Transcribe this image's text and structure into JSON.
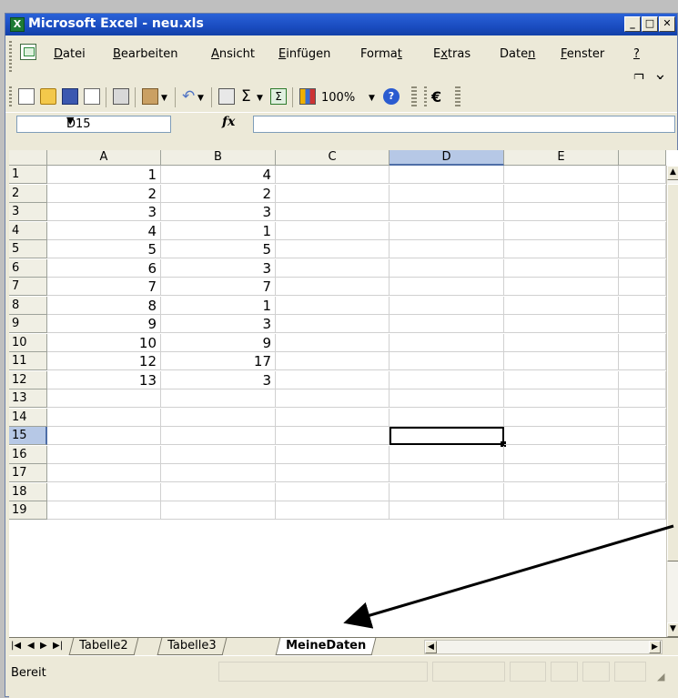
{
  "window": {
    "title": "Microsoft Excel - neu.xls"
  },
  "menu": {
    "items": [
      {
        "label": "Datei",
        "mn": "D"
      },
      {
        "label": "Bearbeiten",
        "mn": "B"
      },
      {
        "label": "Ansicht",
        "mn": "A"
      },
      {
        "label": "Einfügen",
        "mn": "E"
      },
      {
        "label": "Format",
        "mn": "t"
      },
      {
        "label": "Extras",
        "mn": "x"
      },
      {
        "label": "Daten",
        "mn": "n"
      },
      {
        "label": "Fenster",
        "mn": "F"
      },
      {
        "label": "?",
        "mn": "?"
      }
    ]
  },
  "toolbar": {
    "zoom": "100%",
    "euro": "€",
    "sum": "Σ"
  },
  "formula_bar": {
    "cell_ref": "D15",
    "fx": "fx",
    "value": ""
  },
  "columns": [
    "A",
    "B",
    "C",
    "D",
    "E"
  ],
  "selected_column": "D",
  "selected_row": 15,
  "active_cell": "D15",
  "rows": [
    {
      "n": "1",
      "a": "1",
      "b": "4"
    },
    {
      "n": "2",
      "a": "2",
      "b": "2"
    },
    {
      "n": "3",
      "a": "3",
      "b": "3"
    },
    {
      "n": "4",
      "a": "4",
      "b": "1"
    },
    {
      "n": "5",
      "a": "5",
      "b": "5"
    },
    {
      "n": "6",
      "a": "6",
      "b": "3"
    },
    {
      "n": "7",
      "a": "7",
      "b": "7"
    },
    {
      "n": "8",
      "a": "8",
      "b": "1"
    },
    {
      "n": "9",
      "a": "9",
      "b": "3"
    },
    {
      "n": "10",
      "a": "10",
      "b": "9"
    },
    {
      "n": "11",
      "a": "12",
      "b": "17"
    },
    {
      "n": "12",
      "a": "13",
      "b": "3"
    },
    {
      "n": "13",
      "a": "",
      "b": ""
    },
    {
      "n": "14",
      "a": "",
      "b": ""
    },
    {
      "n": "15",
      "a": "",
      "b": ""
    },
    {
      "n": "16",
      "a": "",
      "b": ""
    },
    {
      "n": "17",
      "a": "",
      "b": ""
    },
    {
      "n": "18",
      "a": "",
      "b": ""
    },
    {
      "n": "19",
      "a": "",
      "b": ""
    }
  ],
  "sheets": [
    {
      "label": "Tabelle2",
      "active": false
    },
    {
      "label": "Tabelle3",
      "active": false
    },
    {
      "label": "MeineDaten",
      "active": true
    }
  ],
  "status": {
    "text": "Bereit"
  },
  "colors": {
    "title_bar": "#1a4cc0",
    "selected_header": "#b6c8e6",
    "annotation_arrow": "#000000"
  }
}
